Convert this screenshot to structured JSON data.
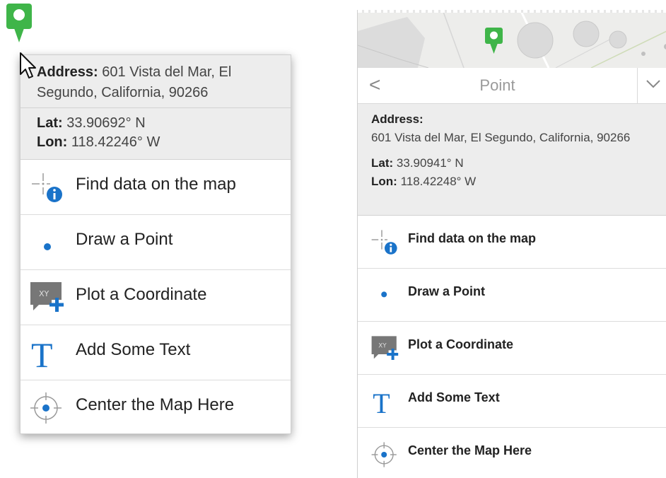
{
  "left_popup": {
    "address_label": "Address:",
    "address_value": "601 Vista del Mar, El Segundo, California, 90266",
    "lat_label": "Lat:",
    "lat_value": "33.90692° N",
    "lon_label": "Lon:",
    "lon_value": "118.42246° W",
    "items": [
      {
        "label": "Find data on the map",
        "icon": "find-data-icon"
      },
      {
        "label": "Draw a Point",
        "icon": "point-icon"
      },
      {
        "label": "Plot a Coordinate",
        "icon": "plot-coordinate-icon"
      },
      {
        "label": "Add Some Text",
        "icon": "text-icon"
      },
      {
        "label": "Center the Map Here",
        "icon": "center-map-icon"
      }
    ]
  },
  "right_panel": {
    "title": "Point",
    "back_glyph": "<",
    "address_label": "Address:",
    "address_value": "601 Vista del Mar, El Segundo, California, 90266",
    "lat_label": "Lat:",
    "lat_value": "33.90941° N",
    "lon_label": "Lon:",
    "lon_value": "118.42248° W",
    "items": [
      {
        "label": "Find data on the map",
        "icon": "find-data-icon"
      },
      {
        "label": "Draw a Point",
        "icon": "point-icon"
      },
      {
        "label": "Plot a Coordinate",
        "icon": "plot-coordinate-icon"
      },
      {
        "label": "Add Some Text",
        "icon": "text-icon"
      },
      {
        "label": "Center the Map Here",
        "icon": "center-map-icon"
      }
    ]
  },
  "colors": {
    "pin_green": "#3fb549",
    "icon_blue": "#1a73c9",
    "header_gray": "#ededed"
  }
}
